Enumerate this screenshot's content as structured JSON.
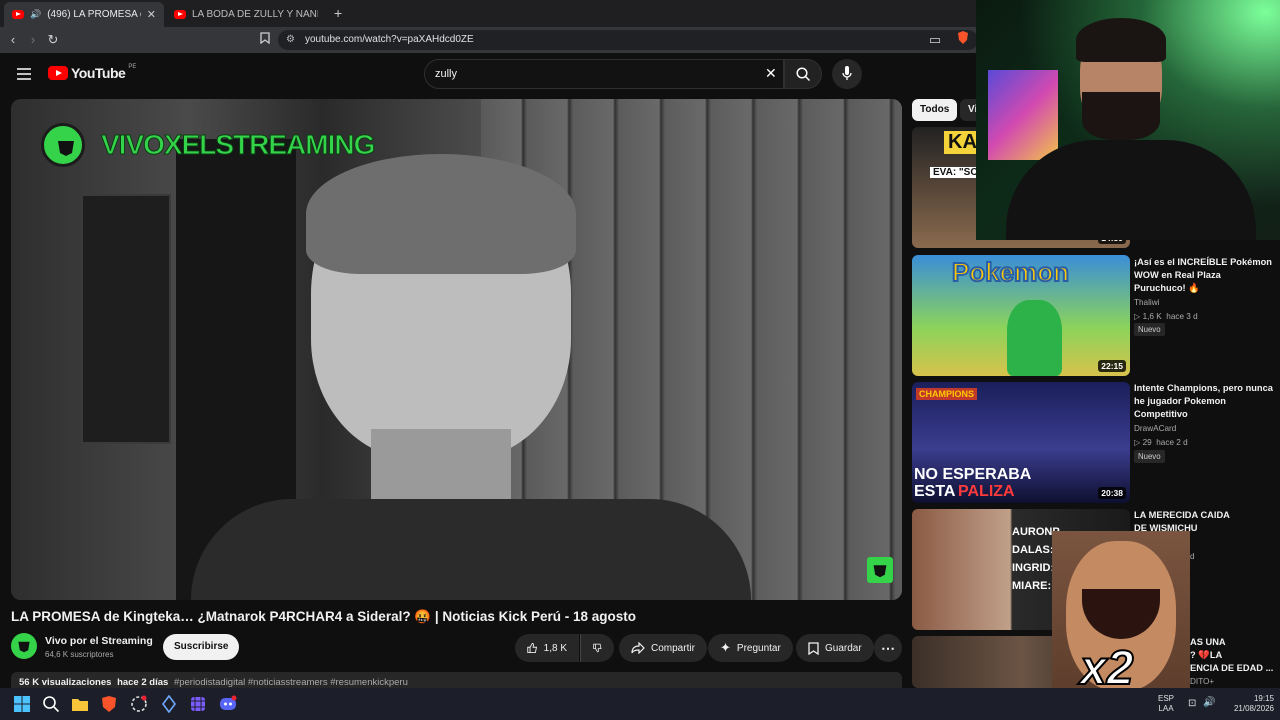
{
  "browser": {
    "tabs": [
      {
        "label": "(496) LA PROMESA de Kingte",
        "active": true
      },
      {
        "label": "LA BODA DE ZULLY Y NANDO EN PE",
        "active": false
      }
    ],
    "url": "youtube.com/watch?v=paXAHdcd0ZE"
  },
  "youtube": {
    "logo_text": "YouTube",
    "region": "PE",
    "search_value": "zully"
  },
  "video": {
    "overlay_text": "VIVOXELSTREAMING",
    "title": "LA PROMESA de Kingteka… ¿Matnarok P4RCHAR4 a Sideral? 🤬 | Noticias Kick Perú - 18 agosto",
    "channel": {
      "name": "Vivo por el Streaming",
      "subscribers": "64,6 K suscriptores",
      "subscribe_label": "Suscribirse"
    },
    "actions": {
      "likes": "1,8 K",
      "share": "Compartir",
      "ask": "Preguntar",
      "save": "Guardar"
    },
    "description": {
      "views": "56 K visualizaciones",
      "date": "hace 2 días",
      "tags": "#periodistadigital #noticiasstreamers #resumenkickperu"
    }
  },
  "sidebar": {
    "chips": [
      "Todos",
      "Vi"
    ],
    "items": [
      {
        "title_line": "",
        "channel": "",
        "meta": "",
        "duration": "14:59",
        "thumb_text": "KAG",
        "thumb_sub": "EVA: \"SOL"
      },
      {
        "title": "¡Así es el INCREÍBLE Pokémon WOW en Real Plaza Puruchuco! 🔥",
        "channel": "Thaliwi",
        "views": "1,6 K",
        "age": "hace 3 d",
        "badge": "Nuevo",
        "duration": "22:15",
        "thumb_text": "Pokemon"
      },
      {
        "title": "Intente Champions, pero nunca he jugador Pokemon Competitivo",
        "channel": "DrawACard",
        "views": "29",
        "age": "hace 2 d",
        "badge": "Nuevo",
        "duration": "20:38",
        "thumb_text_1": "NO ESPERABA",
        "thumb_text_2": "ESTA",
        "thumb_text_3": "PALIZA",
        "thumb_logo": "CHAMPIONS"
      },
      {
        "title": "LA MERECIDA CAIDA DE WISMICHU",
        "meta_partial": "d",
        "thumb_lines": [
          "AURONP",
          "DALAS: F",
          "INGRID:",
          "MIARE: D"
        ]
      },
      {
        "title_partial_1": "AS UNA",
        "title_partial_2": "? 💔LA",
        "title_partial_3": "ENCIA DE EDAD ...",
        "channel_partial": "DITO+"
      }
    ]
  },
  "meme": {
    "text": "x2"
  },
  "taskbar": {
    "lang_1": "ESP",
    "lang_2": "LAA",
    "time": "19:15",
    "date": "21/08/2026"
  },
  "colors": {
    "yt_red": "#ff0000",
    "bg": "#0f0f0f",
    "green_logo": "#35d34a"
  }
}
